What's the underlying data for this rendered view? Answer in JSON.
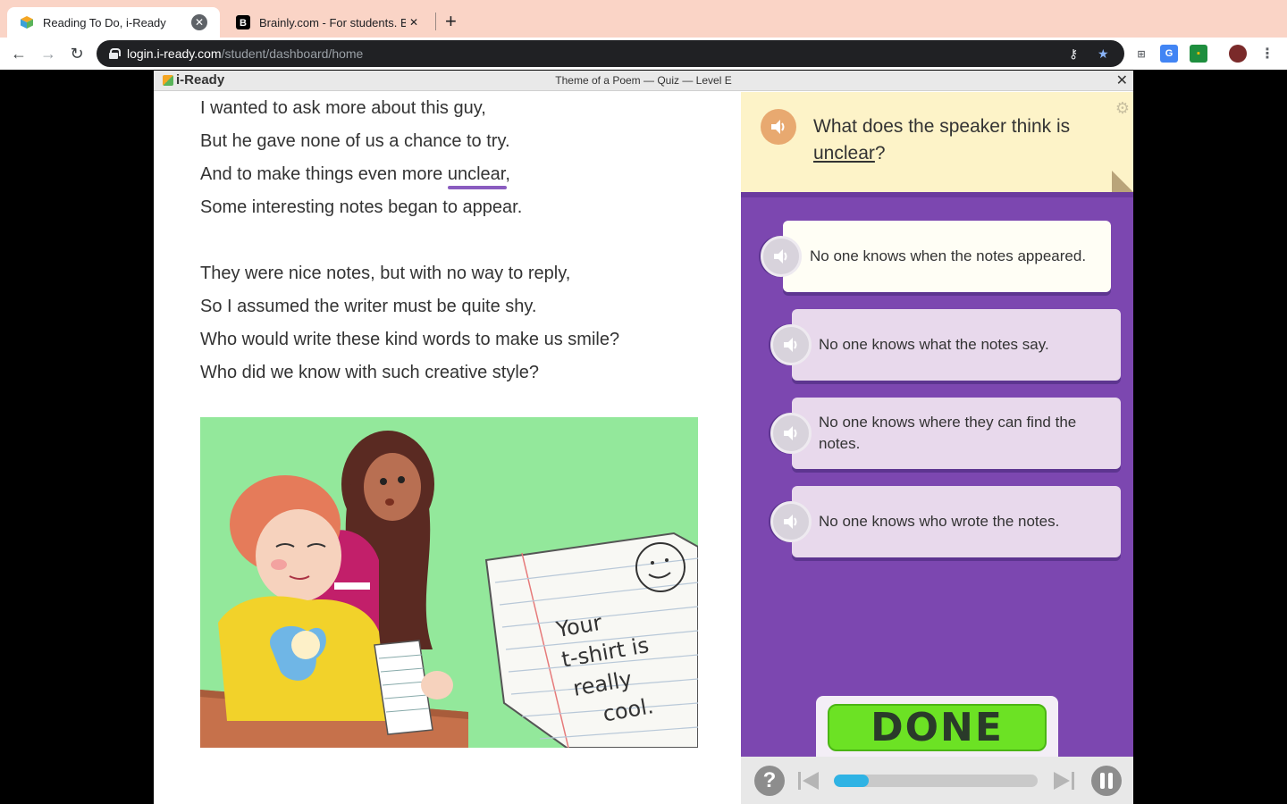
{
  "browser": {
    "tabs": [
      {
        "title": "Reading To Do, i-Ready",
        "active": true
      },
      {
        "title": "Brainly.com - For students. By",
        "active": false
      }
    ],
    "new_tab_label": "+",
    "url_host": "login.i-ready.com",
    "url_path": "/student/dashboard/home"
  },
  "app": {
    "logo": "i-Ready",
    "title": "Theme of a Poem — Quiz — Level E",
    "close_label": "✕"
  },
  "passage": {
    "stanza1": [
      "I wanted to ask more about this guy,",
      "But he gave none of us a chance to try.",
      "And to make things even more ",
      "Some interesting notes began to appear."
    ],
    "underlined_word": "unclear",
    "after_word": ",",
    "stanza2": [
      "They were nice notes, but with no way to reply,",
      "So I assumed the writer must be quite shy.",
      "Who would write these kind words to make us smile?",
      "Who did we know with such creative style?"
    ],
    "note_text": [
      "Your",
      "t-shirt is",
      "really",
      "cool."
    ]
  },
  "question": {
    "prefix": "What does the speaker think is",
    "underlined": "unclear",
    "suffix": "?"
  },
  "answers": [
    "No one knows when the notes appeared.",
    "No one knows what the notes say.",
    "No one knows where they can find the notes.",
    "No one knows who wrote the notes."
  ],
  "done_label": "DONE",
  "controls": {
    "help_label": "?",
    "progress_fraction": 0.17
  },
  "colors": {
    "panel_purple": "#7c47b0",
    "header_yellow": "#fdf3c8",
    "done_green": "#6ce224",
    "progress_blue": "#2fb3e4",
    "tabbar_peach": "#fad4c6"
  }
}
